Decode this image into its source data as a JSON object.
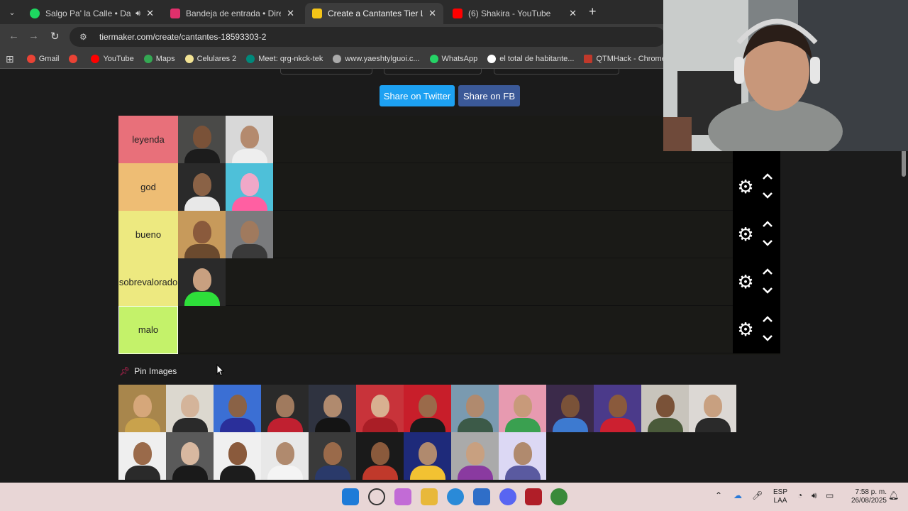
{
  "tabs": [
    {
      "title": "Salgo Pa' la Calle • Daddy Yankee",
      "favicon_color": "#1ed760",
      "active": false
    },
    {
      "title": "Bandeja de entrada • Direct",
      "favicon_color": "#e1306c",
      "active": false
    },
    {
      "title": "Create a Cantantes Tier List - TierMaker",
      "favicon_color": "#f5c518",
      "active": true
    },
    {
      "title": "(6) Shakira - YouTube",
      "favicon_color": "#ff0000",
      "active": false
    }
  ],
  "address": {
    "url": "tiermaker.com/create/cantantes-18593303-2"
  },
  "bookmarks": [
    {
      "label": "Gmail",
      "color": "#ea4335"
    },
    {
      "label": "",
      "color": "#ea4335"
    },
    {
      "label": "YouTube",
      "color": "#ff0000"
    },
    {
      "label": "Maps",
      "color": "#34a853"
    },
    {
      "label": "Celulares 2",
      "color": "#f2e394"
    },
    {
      "label": "Meet: qrg-nkck-tek",
      "color": "#00897b"
    },
    {
      "label": "www.yaeshtylguoi.c...",
      "color": "#aaaaaa"
    },
    {
      "label": "WhatsApp",
      "color": "#25d366"
    },
    {
      "label": "el total de habitante...",
      "color": "#ffffff"
    },
    {
      "label": "QTMHack - Chrome...",
      "color": "#c0392b"
    }
  ],
  "share": {
    "twitter": "Share on Twitter",
    "fb": "Share on FB",
    "twitter_color": "#1da1f2",
    "fb_color": "#3b5998"
  },
  "tiers": [
    {
      "label": "leyenda",
      "color": "#e8707a",
      "items": [
        {
          "bg": "#4a4a48",
          "skin": "#7a5238",
          "shirt": "#1c1c1c"
        },
        {
          "bg": "#d8d8d8",
          "skin": "#b48a6e",
          "shirt": "#eeeeee"
        }
      ]
    },
    {
      "label": "god",
      "color": "#eebd74",
      "items": [
        {
          "bg": "#2a2a2a",
          "skin": "#8a6246",
          "shirt": "#e8e8e8"
        },
        {
          "bg": "#4ec0d9",
          "skin": "#f0a8c8",
          "shirt": "#ff5fa2"
        }
      ]
    },
    {
      "label": "bueno",
      "color": "#ede980",
      "items": [
        {
          "bg": "#c79a5b",
          "skin": "#8a5a3c",
          "shirt": "#6b4a2e"
        },
        {
          "bg": "#7a7b7d",
          "skin": "#a07a5e",
          "shirt": "#3a3a3a"
        }
      ]
    },
    {
      "label": "sobrevalorado",
      "color": "#ede980",
      "items": [
        {
          "bg": "#2a2a2a",
          "skin": "#c8a080",
          "shirt": "#2edf3a"
        }
      ]
    },
    {
      "label": "malo",
      "color": "#c4f26a",
      "items": []
    }
  ],
  "pin": {
    "label": "Pin Images"
  },
  "pool": [
    {
      "bg": "#a8864c",
      "skin": "#d6a77a",
      "shirt": "#c9a24c"
    },
    {
      "bg": "#dcd8cf",
      "skin": "#d4b49a",
      "shirt": "#2a2a2a"
    },
    {
      "bg": "#3b6fd4",
      "skin": "#8a6246",
      "shirt": "#2a2f9a"
    },
    {
      "bg": "#2a2a2a",
      "skin": "#a07a5e",
      "shirt": "#c02030"
    },
    {
      "bg": "#2f3340",
      "skin": "#b08a6e",
      "shirt": "#141414"
    },
    {
      "bg": "#c8333a",
      "skin": "#d8b090",
      "shirt": "#aa1e26"
    },
    {
      "bg": "#c81e2a",
      "skin": "#9a6a4a",
      "shirt": "#1a1a1a"
    },
    {
      "bg": "#7a9ab0",
      "skin": "#b08a6e",
      "shirt": "#3c5a48"
    },
    {
      "bg": "#e79ab0",
      "skin": "#c89a7a",
      "shirt": "#3aa050"
    },
    {
      "bg": "#3b2a4a",
      "skin": "#7a5238",
      "shirt": "#3d7ad0"
    },
    {
      "bg": "#4b3a8a",
      "skin": "#8a5a3c",
      "shirt": "#cc2030"
    },
    {
      "bg": "#c8c4bc",
      "skin": "#7a5238",
      "shirt": "#4a5a3a"
    },
    {
      "bg": "#dcd8d4",
      "skin": "#c8a080",
      "shirt": "#2a2a2a"
    },
    {
      "bg": "#efefef",
      "skin": "#9a6a4a",
      "shirt": "#2a2a2a"
    },
    {
      "bg": "#5a5a5a",
      "skin": "#d8b8a0",
      "shirt": "#1a1a1a"
    },
    {
      "bg": "#f0f0f0",
      "skin": "#8a5a3c",
      "shirt": "#1c1c1c"
    },
    {
      "bg": "#e8e8e8",
      "skin": "#b08a6e",
      "shirt": "#f4f4f4"
    },
    {
      "bg": "#3a3a3a",
      "skin": "#9a6a4a",
      "shirt": "#2a3a6a"
    },
    {
      "bg": "#1a1a1a",
      "skin": "#8a5a3c",
      "shirt": "#c0392b"
    },
    {
      "bg": "#1e2a7a",
      "skin": "#b08a6e",
      "shirt": "#f2c232"
    },
    {
      "bg": "#aaaaaa",
      "skin": "#c8a080",
      "shirt": "#8a3aa0"
    },
    {
      "bg": "#dcd8f4",
      "skin": "#b08a6e",
      "shirt": "#5a5aa0"
    }
  ],
  "taskbar": {
    "lang": "ESP",
    "layout": "LAA",
    "time": "7:58 p. m.",
    "date": "26/08/2025"
  }
}
